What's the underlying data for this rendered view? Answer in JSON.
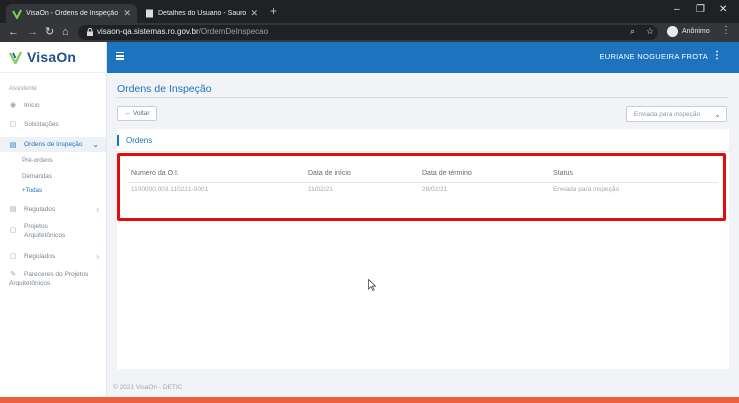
{
  "browser": {
    "tabs": [
      {
        "title": "VisaOn - Ordens de Inspeção",
        "active": true
      },
      {
        "title": "Detalhes do Usuario - Sauron.Go",
        "active": false
      }
    ],
    "url_host": "visaon-qa.sistemas.ro.gov.br",
    "url_path": "/OrdemDeInspecao",
    "profile_label": "Anônimo"
  },
  "app": {
    "brand": "VisaOn",
    "user_name": "EURIANE NOGUEIRA FROTA",
    "accent_color": "#1e73be",
    "highlight_color": "#e10c0c"
  },
  "sidebar": {
    "section_label": "Assistente",
    "items": [
      {
        "label": "Início",
        "icon": "dashboard-icon"
      },
      {
        "label": "Solicitações",
        "icon": "calendar-icon"
      },
      {
        "label": "Ordens de Inspeção",
        "icon": "document-icon",
        "active": true
      },
      {
        "label": "Regulados",
        "icon": "document-icon"
      },
      {
        "label": "Projetos Arquitetônicos",
        "icon": "calendar-icon"
      },
      {
        "label": "Regulados",
        "icon": "document-icon"
      },
      {
        "label": "Pareceres do Projetos Arquitetônicos",
        "icon": "pencil-icon"
      }
    ],
    "subitems": [
      "Pré-ordens",
      "Demandas",
      "+Todas"
    ]
  },
  "main": {
    "page_title": "Ordens de Inspeção",
    "back_label": "Voltar",
    "status_filter": "Enviada para inspeção",
    "card_title": "Ordens",
    "columns": [
      "Numero da O.I.",
      "Data de início",
      "Data de término",
      "Status"
    ],
    "rows": [
      [
        "1100000,003.110221-0001",
        "11/02/21",
        "28/02/21",
        "Enviada para inspeção"
      ]
    ]
  },
  "footer": "© 2021 VisaOn - DETIC"
}
